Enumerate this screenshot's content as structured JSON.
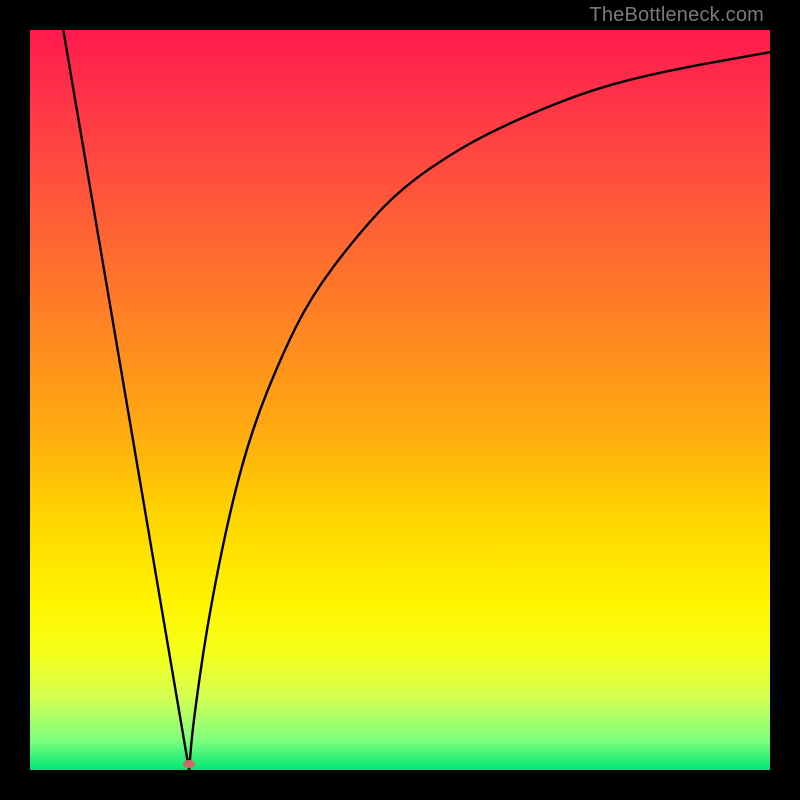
{
  "watermark": {
    "text": "TheBottleneck.com"
  },
  "marker": {
    "color": "#cf6a6a",
    "x_pct": 21.5,
    "y_pct": 99.2
  },
  "gradient_colors": {
    "top": "#ff1a4d",
    "mid_upper": "#ff8a20",
    "mid_lower": "#fff600",
    "bottom": "#00e676"
  },
  "chart_data": {
    "type": "line",
    "title": "",
    "xlabel": "",
    "ylabel": "",
    "xlim_pct": [
      0,
      100
    ],
    "ylim_pct": [
      0,
      100
    ],
    "series": [
      {
        "name": "bottleneck-curve",
        "x_pct": [
          4.5,
          8,
          12,
          16,
          20,
          21.5,
          22,
          24,
          27,
          30,
          34,
          38,
          44,
          50,
          58,
          66,
          76,
          86,
          100
        ],
        "y_pct": [
          100,
          80,
          60,
          40,
          16,
          0,
          6,
          20,
          35,
          46,
          56,
          64,
          72,
          78.5,
          84,
          88,
          92,
          94.5,
          97
        ]
      }
    ],
    "marker_point": {
      "x_pct": 21.5,
      "y_pct": 0
    },
    "grid": false,
    "legend": false,
    "notes": "Percent coordinates are relative to the inner plot area; y_pct measured from bottom upward. Color gradient encodes bottleneck severity: red = high, green = low."
  }
}
